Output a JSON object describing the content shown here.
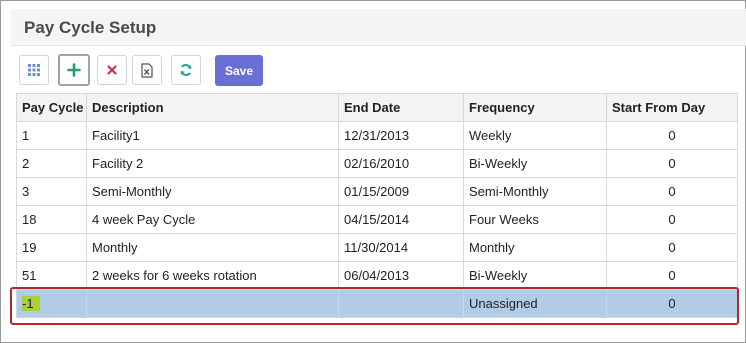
{
  "page": {
    "title": "Pay Cycle Setup"
  },
  "toolbar": {
    "buttons": [
      {
        "name": "columns-button",
        "icon": "grid-icon",
        "color": "#5b7fbf"
      },
      {
        "name": "add-button",
        "icon": "plus-icon",
        "color": "#2aa198"
      },
      {
        "name": "delete-button",
        "icon": "close-icon",
        "color": "#d0314d"
      },
      {
        "name": "export-button",
        "icon": "excel-icon",
        "color": "#555555"
      },
      {
        "name": "refresh-button",
        "icon": "refresh-icon",
        "color": "#2aa198"
      }
    ],
    "save_label": "Save",
    "save_color": "#6a6fd6"
  },
  "table": {
    "columns": [
      "Pay Cycle",
      "Description",
      "End Date",
      "Frequency",
      "Start From Day"
    ],
    "rows": [
      {
        "pay_cycle": "1",
        "description": "Facility1",
        "end_date": "12/31/2013",
        "frequency": "Weekly",
        "start_from_day": "0"
      },
      {
        "pay_cycle": "2",
        "description": "Facility 2",
        "end_date": "02/16/2010",
        "frequency": "Bi-Weekly",
        "start_from_day": "0"
      },
      {
        "pay_cycle": "3",
        "description": "Semi-Monthly",
        "end_date": "01/15/2009",
        "frequency": "Semi-Monthly",
        "start_from_day": "0"
      },
      {
        "pay_cycle": "18",
        "description": "4 week Pay Cycle",
        "end_date": "04/15/2014",
        "frequency": "Four Weeks",
        "start_from_day": "0"
      },
      {
        "pay_cycle": "19",
        "description": "Monthly",
        "end_date": "11/30/2014",
        "frequency": "Monthly",
        "start_from_day": "0"
      },
      {
        "pay_cycle": "51",
        "description": "2 weeks for 6 weeks rotation",
        "end_date": "06/04/2013",
        "frequency": "Bi-Weekly",
        "start_from_day": "0"
      },
      {
        "pay_cycle": "-1",
        "description": "",
        "end_date": "",
        "frequency": "Unassigned",
        "start_from_day": "0"
      }
    ],
    "selected_row_color": "#b2cbe6",
    "highlight_color": "#a9cf3c",
    "outline_color": "#b3282d"
  }
}
